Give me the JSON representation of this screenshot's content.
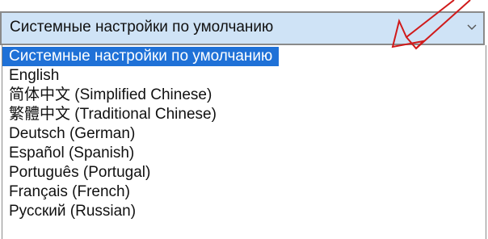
{
  "language_select": {
    "selected_value": "Системные настройки по умолчанию",
    "options": [
      "Системные настройки по умолчанию",
      "English",
      "简体中文 (Simplified Chinese)",
      "繁體中文 (Traditional Chinese)",
      "Deutsch (German)",
      "Español (Spanish)",
      "Português (Portugal)",
      "Français (French)",
      "Русский (Russian)"
    ],
    "highlighted_index": 0
  },
  "icons": {
    "dropdown": "chevron-down-icon",
    "annotation": "red-arrow-icon"
  },
  "colors": {
    "field_background": "#cfe3f6",
    "highlight": "#1f71d7",
    "arrow": "#d01a1a"
  }
}
